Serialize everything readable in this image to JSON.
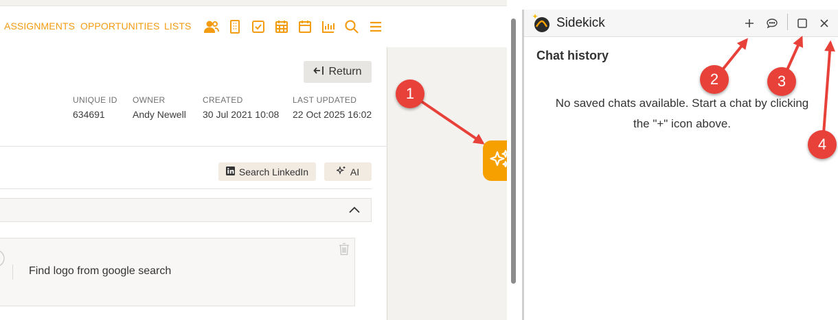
{
  "nav": {
    "links": [
      "ASSIGNMENTS",
      "OPPORTUNITIES",
      "LISTS"
    ],
    "icons": [
      "contacts-icon",
      "company-icon",
      "tasks-icon",
      "calendar-grid-icon",
      "calendar-icon",
      "reports-icon",
      "search-icon",
      "menu-icon"
    ]
  },
  "record": {
    "return_label": "Return",
    "meta": [
      {
        "label": "UNIQUE ID",
        "value": "634691"
      },
      {
        "label": "OWNER",
        "value": "Andy Newell"
      },
      {
        "label": "CREATED",
        "value": "30 Jul 2021 10:08"
      },
      {
        "label": "LAST UPDATED",
        "value": "22 Oct 2025 16:02"
      }
    ],
    "search_linkedin_label": "Search LinkedIn",
    "ai_label": "AI",
    "task_text": "Find logo from google search"
  },
  "sidekick": {
    "title": "Sidekick",
    "chat_history_title": "Chat history",
    "empty_message": "No saved chats available. Start a chat by clicking the \"+\" icon above."
  },
  "callouts": [
    "1",
    "2",
    "3",
    "4"
  ],
  "colors": {
    "accent": "#f39c12",
    "launcher": "#f6a000",
    "callout": "#e8413a"
  }
}
